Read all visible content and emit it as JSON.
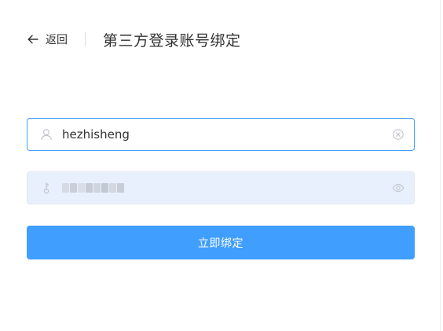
{
  "header": {
    "back_label": "返回",
    "title": "第三方登录账号绑定"
  },
  "form": {
    "username": {
      "value": "hezhisheng",
      "icon": "user-icon",
      "clear_icon": "clear-icon"
    },
    "password": {
      "icon": "key-icon",
      "toggle_icon": "eye-icon"
    },
    "submit_label": "立即绑定"
  },
  "colors": {
    "primary": "#409eff",
    "autofill_bg": "#e8f0fe",
    "text": "#303133",
    "icon": "#c0c4cc"
  }
}
